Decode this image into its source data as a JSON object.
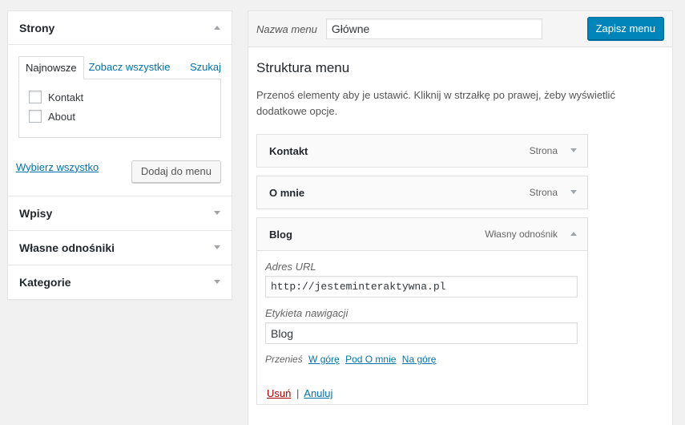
{
  "sidebar": {
    "pages_title": "Strony",
    "tabs": [
      "Najnowsze",
      "Zobacz wszystkie",
      "Szukaj"
    ],
    "pages": [
      "Kontakt",
      "About"
    ],
    "select_all": "Wybierz wszystko",
    "add_to_menu": "Dodaj do menu",
    "sections": [
      "Wpisy",
      "Własne odnośniki",
      "Kategorie"
    ]
  },
  "header": {
    "menu_name_label": "Nazwa menu",
    "menu_name_value": "Główne",
    "save_label": "Zapisz menu"
  },
  "structure": {
    "title": "Struktura menu",
    "description": "Przenoś elementy aby je ustawić. Kliknij w strzałkę po prawej, żeby wyświetlić dodatkowe opcje."
  },
  "menu_items": [
    {
      "title": "Kontakt",
      "type": "Strona"
    },
    {
      "title": "O mnie",
      "type": "Strona"
    },
    {
      "title": "Blog",
      "type": "Własny odnośnik"
    }
  ],
  "item_settings": {
    "url_label": "Adres URL",
    "url_value": "http://jesteminteraktywna.pl",
    "nav_label": "Etykieta nawigacji",
    "nav_value": "Blog",
    "move_label": "Przenieś",
    "move_links": [
      "W górę",
      "Pod O mnie",
      "Na górę"
    ],
    "remove": "Usuń",
    "separator": "|",
    "cancel": "Anuluj"
  },
  "colors": {
    "primary_button": "#0085ba",
    "link": "#0073aa",
    "delete": "#a00000"
  }
}
